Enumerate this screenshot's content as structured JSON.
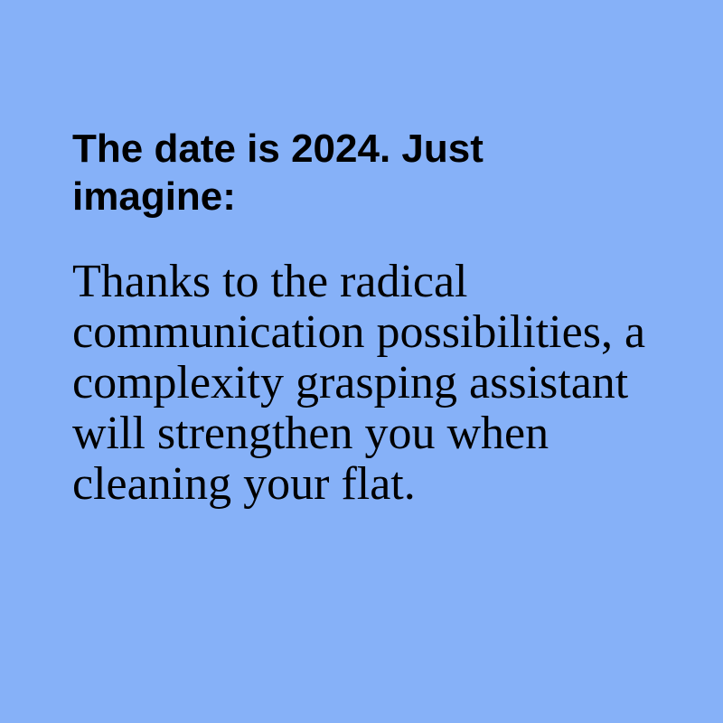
{
  "background_color": "#86b1f8",
  "text_color": "#000000",
  "heading": "The date is 2024. Just imagine:",
  "body": "Thanks to the radical communication possibilities, a complexity grasping assistant will strengthen you when cleaning your flat."
}
